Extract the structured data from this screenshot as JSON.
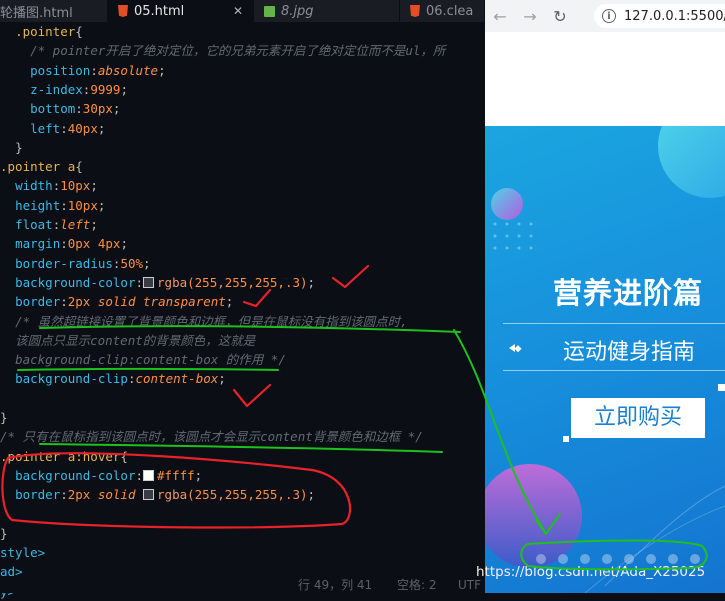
{
  "tabs": [
    {
      "label": "轮播图.html",
      "active": false
    },
    {
      "label": "05.html",
      "active": true,
      "close": "✕"
    },
    {
      "label": "8.jpg",
      "active": false
    },
    {
      "label": "06.clea",
      "active": false
    }
  ],
  "code_lines": [
    [
      {
        "t": "  "
      },
      {
        "t": ".pointer",
        "c": "sel"
      },
      {
        "t": "{",
        "c": "pun"
      }
    ],
    [
      {
        "t": "    "
      },
      {
        "t": "/* pointer开启了绝对定位，它的兄弟元素开启了绝对定位而不是ul，所",
        "c": "cm"
      }
    ],
    [
      {
        "t": "    "
      },
      {
        "t": "position",
        "c": "prop"
      },
      {
        "t": ":",
        "c": "pun"
      },
      {
        "t": "absolute",
        "c": "kw"
      },
      {
        "t": ";",
        "c": "pun"
      }
    ],
    [
      {
        "t": "    "
      },
      {
        "t": "z-index",
        "c": "prop"
      },
      {
        "t": ":",
        "c": "pun"
      },
      {
        "t": "9999",
        "c": "num"
      },
      {
        "t": ";",
        "c": "pun"
      }
    ],
    [
      {
        "t": "    "
      },
      {
        "t": "bottom",
        "c": "prop"
      },
      {
        "t": ":",
        "c": "pun"
      },
      {
        "t": "30px",
        "c": "num"
      },
      {
        "t": ";",
        "c": "pun"
      }
    ],
    [
      {
        "t": "    "
      },
      {
        "t": "left",
        "c": "prop"
      },
      {
        "t": ":",
        "c": "pun"
      },
      {
        "t": "40px",
        "c": "num"
      },
      {
        "t": ";",
        "c": "pun"
      }
    ],
    [
      {
        "t": "  "
      },
      {
        "t": "}",
        "c": "pun"
      }
    ],
    [
      {
        "t": ".pointer a",
        "c": "sel"
      },
      {
        "t": "{",
        "c": "pun"
      }
    ],
    [
      {
        "t": "  "
      },
      {
        "t": "width",
        "c": "prop"
      },
      {
        "t": ":",
        "c": "pun"
      },
      {
        "t": "10px",
        "c": "num"
      },
      {
        "t": ";",
        "c": "pun"
      }
    ],
    [
      {
        "t": "  "
      },
      {
        "t": "height",
        "c": "prop"
      },
      {
        "t": ":",
        "c": "pun"
      },
      {
        "t": "10px",
        "c": "num"
      },
      {
        "t": ";",
        "c": "pun"
      }
    ],
    [
      {
        "t": "  "
      },
      {
        "t": "float",
        "c": "prop"
      },
      {
        "t": ":",
        "c": "pun"
      },
      {
        "t": "left",
        "c": "kw"
      },
      {
        "t": ";",
        "c": "pun"
      }
    ],
    [
      {
        "t": "  "
      },
      {
        "t": "margin",
        "c": "prop"
      },
      {
        "t": ":",
        "c": "pun"
      },
      {
        "t": "0px 4px",
        "c": "num"
      },
      {
        "t": ";",
        "c": "pun"
      }
    ],
    [
      {
        "t": "  "
      },
      {
        "t": "border-radius",
        "c": "prop"
      },
      {
        "t": ":",
        "c": "pun"
      },
      {
        "t": "50%",
        "c": "num"
      },
      {
        "t": ";",
        "c": "pun"
      }
    ],
    [
      {
        "t": "  "
      },
      {
        "t": "background-color",
        "c": "prop"
      },
      {
        "t": ":",
        "c": "pun"
      },
      {
        "sw": "#3a3d43"
      },
      {
        "t": "rgba",
        "c": "fn"
      },
      {
        "t": "(255,255,255,.3)",
        "c": "num"
      },
      {
        "t": ";",
        "c": "pun"
      }
    ],
    [
      {
        "t": "  "
      },
      {
        "t": "border",
        "c": "prop"
      },
      {
        "t": ":",
        "c": "pun"
      },
      {
        "t": "2px ",
        "c": "num"
      },
      {
        "t": "solid transparent",
        "c": "kw"
      },
      {
        "t": ";",
        "c": "pun"
      }
    ],
    [
      {
        "t": "  "
      },
      {
        "t": "/* 虽然超链接设置了背景颜色和边框，但是在鼠标没有指到该圆点时,",
        "c": "cm"
      }
    ],
    [
      {
        "t": "  "
      },
      {
        "t": "该圆点只显示content的背景颜色，这就是",
        "c": "cm"
      }
    ],
    [
      {
        "t": "  "
      },
      {
        "t": "background-clip:content-box 的作用 */",
        "c": "cm"
      }
    ],
    [
      {
        "t": "  "
      },
      {
        "t": "background-clip",
        "c": "prop"
      },
      {
        "t": ":",
        "c": "pun"
      },
      {
        "t": "content-box",
        "c": "kw"
      },
      {
        "t": ";",
        "c": "pun"
      }
    ],
    [
      {
        "t": ""
      }
    ],
    [
      {
        "t": "}",
        "c": "pun"
      }
    ],
    [
      {
        "t": "/* 只有在鼠标指到该圆点时，该圆点才会显示content背景颜色和边框 */",
        "c": "cm"
      }
    ],
    [
      {
        "t": ".pointer a:hover",
        "c": "sel"
      },
      {
        "t": "{",
        "c": "pun"
      }
    ],
    [
      {
        "t": "  "
      },
      {
        "t": "background-color",
        "c": "prop"
      },
      {
        "t": ":",
        "c": "pun"
      },
      {
        "sw": "#ffffff"
      },
      {
        "t": "#ffff",
        "c": "num"
      },
      {
        "t": ";",
        "c": "pun"
      }
    ],
    [
      {
        "t": "  "
      },
      {
        "t": "border",
        "c": "prop"
      },
      {
        "t": ":",
        "c": "pun"
      },
      {
        "t": "2px ",
        "c": "num"
      },
      {
        "t": "solid ",
        "c": "kw"
      },
      {
        "sw": "#3a3d43"
      },
      {
        "t": "rgba",
        "c": "fn"
      },
      {
        "t": "(255,255,255,.3)",
        "c": "num"
      },
      {
        "t": ";",
        "c": "pun"
      }
    ],
    [
      {
        "t": ""
      }
    ],
    [
      {
        "t": "}",
        "c": "pun"
      }
    ],
    [
      {
        "t": "style>",
        "c": "tag"
      }
    ],
    [
      {
        "t": "ad>",
        "c": "tag"
      }
    ],
    [
      {
        "t": "y>",
        "c": "tag"
      }
    ]
  ],
  "status": {
    "position": "行 49，列 41",
    "spaces": "空格: 2",
    "encoding": "UTF"
  },
  "browser": {
    "back": "←",
    "forward": "→",
    "reload": "↻",
    "info": "i",
    "url": "127.0.0.1:5500/"
  },
  "banner": {
    "title": "营养进阶篇",
    "subtitle": "运动健身指南",
    "buy_button": "立即购买",
    "pointer_count": 8
  },
  "watermark": "https://blog.csdn.net/Ada_X25025",
  "colors": {
    "annotation_red": "#e8222a",
    "annotation_green": "#1ec01e",
    "banner_blue": "#1790dc"
  }
}
